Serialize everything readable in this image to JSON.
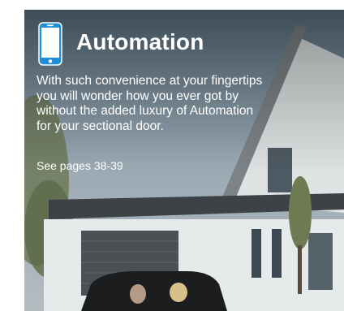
{
  "title": "Automation",
  "body_lines": [
    "With such convenience at your fingertips",
    "you will wonder how you ever got by",
    "without the added luxury of Automation",
    "for your sectional door."
  ],
  "page_reference": "See pages 38-39",
  "icon": "smartphone-icon",
  "colors": {
    "icon_blue": "#1e8fd9",
    "text": "#ffffff"
  }
}
